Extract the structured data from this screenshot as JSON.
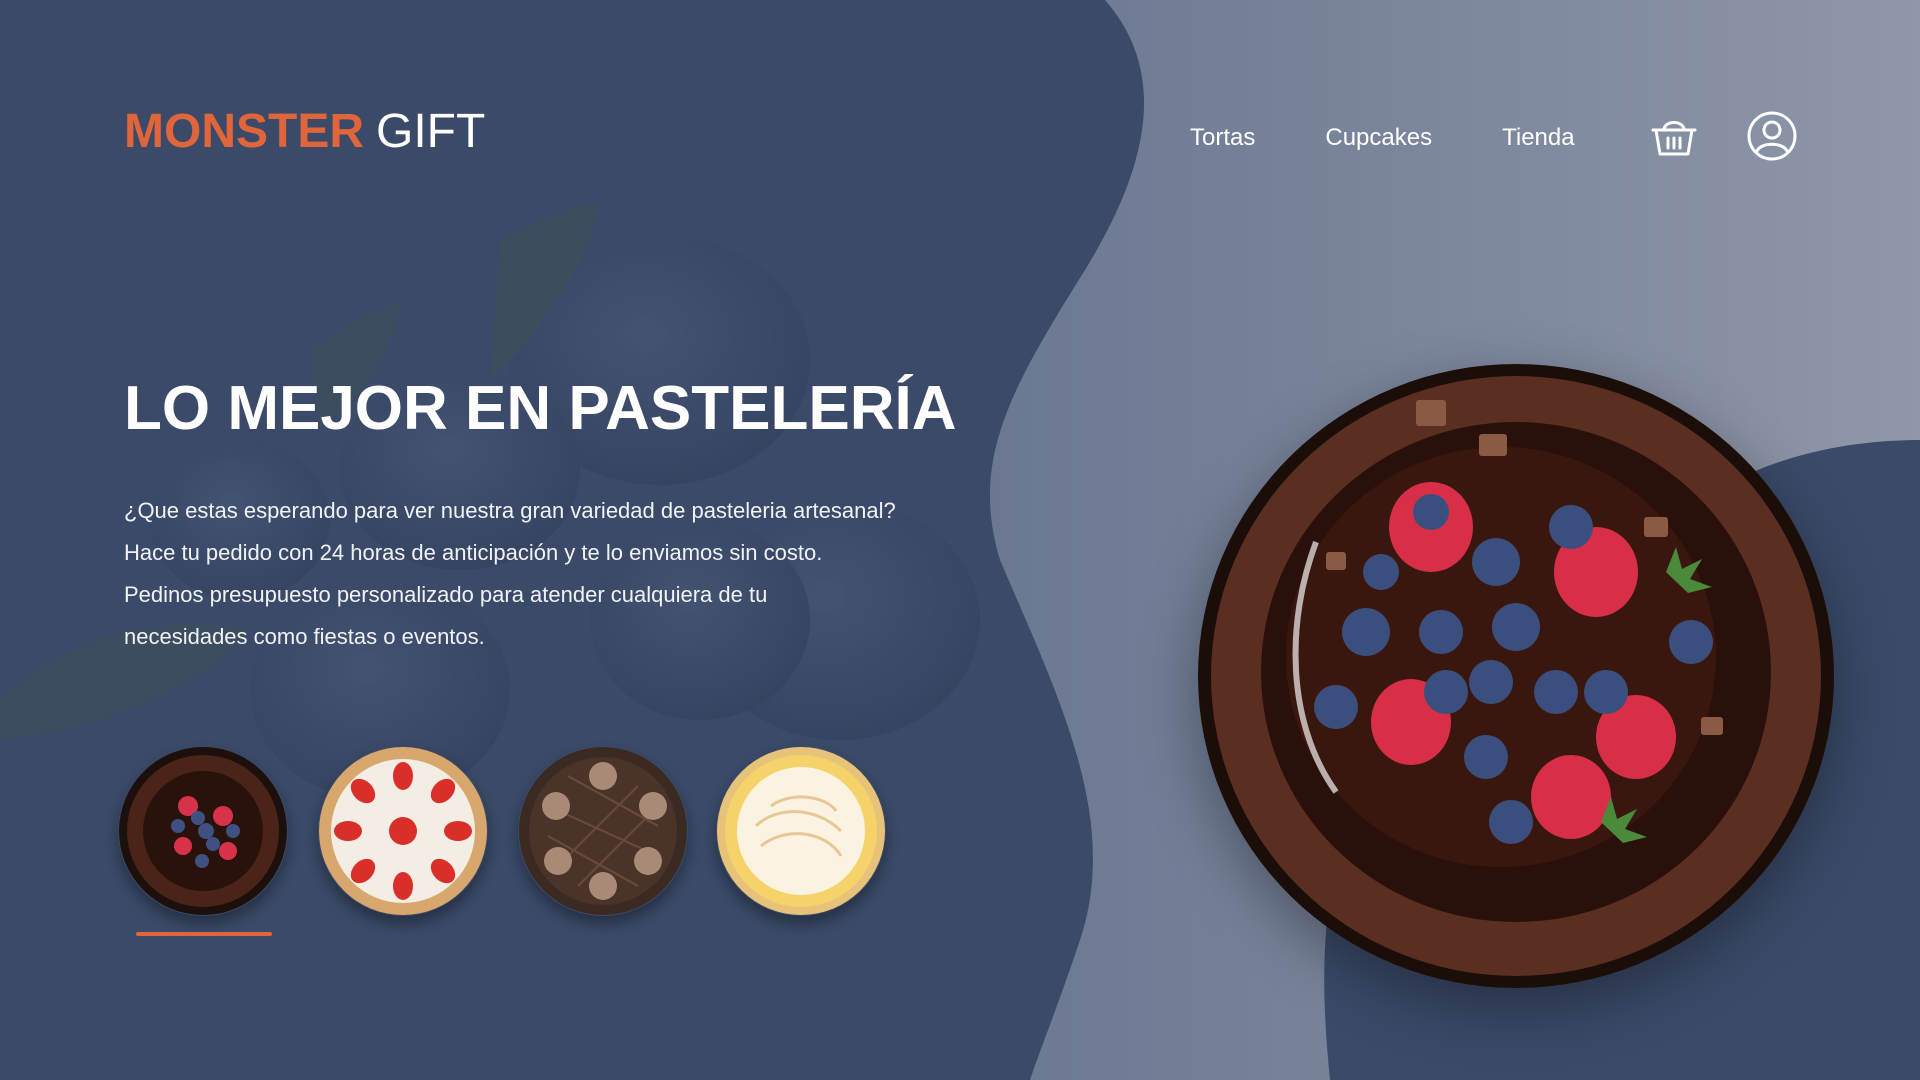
{
  "brand": {
    "accent_text": "MONSTER",
    "main_text": "GIFT",
    "accent_color": "#e0653a"
  },
  "nav": {
    "items": [
      "Tortas",
      "Cupcakes",
      "Tienda"
    ]
  },
  "icons": {
    "cart": "basket-icon",
    "user": "user-account-icon"
  },
  "hero": {
    "title": "LO MEJOR EN PASTELERÍA",
    "lines": [
      "¿Que estas esperando para ver nuestra gran variedad de pasteleria artesanal?",
      "Hace tu pedido con 24 horas de anticipación  y te lo enviamos sin costo.",
      "Pedinos presupuesto personalizado para atender cualquiera de tu",
      "necesidades como fiestas o eventos."
    ]
  },
  "thumbnails": [
    {
      "name": "chocolate-berry-cake",
      "selected": true
    },
    {
      "name": "strawberry-cream-tart",
      "selected": false
    },
    {
      "name": "chocolate-rosette-cake",
      "selected": false
    },
    {
      "name": "lemon-meringue-pie",
      "selected": false
    }
  ],
  "colors": {
    "background_dark": "#3a4a68",
    "background_light": "#7d879d",
    "accent": "#e0653a"
  }
}
